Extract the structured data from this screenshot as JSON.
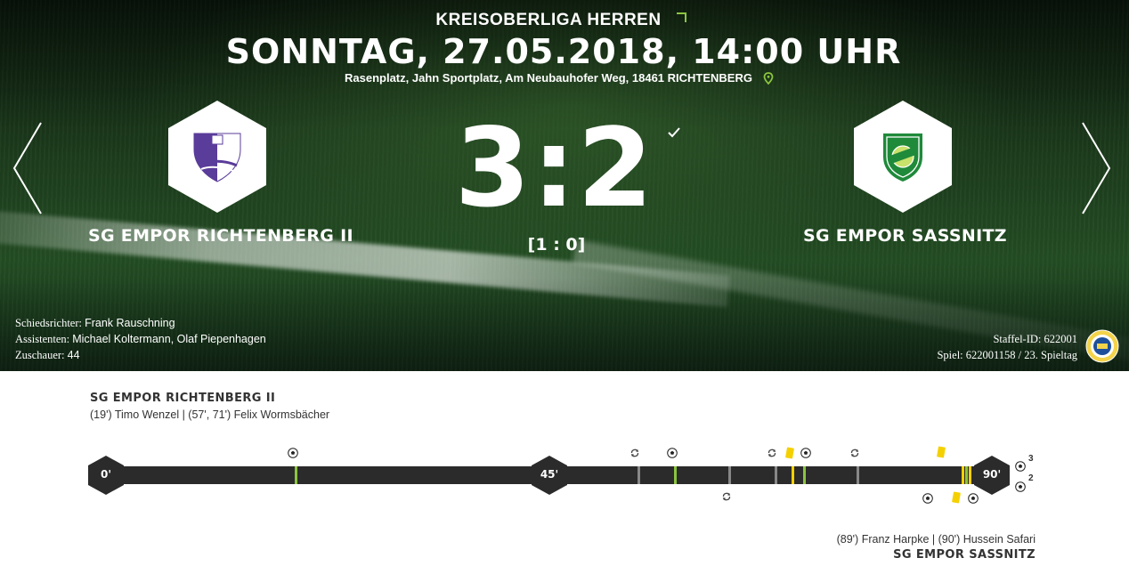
{
  "match": {
    "league": "KREISOBERLIGA HERREN",
    "datetime": "SONNTAG, 27.05.2018, 14:00 UHR",
    "venue": "Rasenplatz, Jahn Sportplatz, Am Neubauhofer Weg, 18461 RICHTENBERG",
    "home_team": "SG EMPOR RICHTENBERG II",
    "away_team": "SG EMPOR SASSNITZ",
    "score": "3:2",
    "halftime": "[1 : 0]"
  },
  "officials": {
    "referee_label": "Schiedsrichter:",
    "referee": "Frank Rauschning",
    "assistants_label": "Assistenten:",
    "assistants": "Michael Koltermann, Olaf Piepenhagen",
    "spectators_label": "Zuschauer:",
    "spectators": "44"
  },
  "meta": {
    "staffel_label": "Staffel-ID:",
    "staffel": "622001",
    "game_label": "Spiel:",
    "game": "622001158 / 23. Spieltag"
  },
  "timeline": {
    "home_team": "SG EMPOR RICHTENBERG II",
    "home_scorers": "(19') Timo Wenzel | (57', 71') Felix Wormsbächer",
    "away_team": "SG EMPOR SASSNITZ",
    "away_scorers": "(89') Franz Harpke | (90') Hussein Safari",
    "start_label": "0'",
    "half_label": "45'",
    "end_label": "90'",
    "home_goals_total": "3",
    "away_goals_total": "2",
    "events_minutes": {
      "home_goals": [
        19,
        57,
        71
      ],
      "away_goals": [
        89,
        90
      ],
      "substitutions": [
        53,
        66,
        78,
        87
      ],
      "yellow_cards": [
        69,
        89,
        90
      ]
    }
  },
  "icons": [
    "chevron-left-icon",
    "chevron-right-icon",
    "map-pin-icon",
    "checkmark-icon",
    "ball-icon",
    "substitution-icon",
    "yellow-card-icon",
    "association-badge-icon"
  ],
  "colors": {
    "accent": "#8bc53f",
    "card": "#f5d000",
    "bar": "#2b2b2b"
  }
}
